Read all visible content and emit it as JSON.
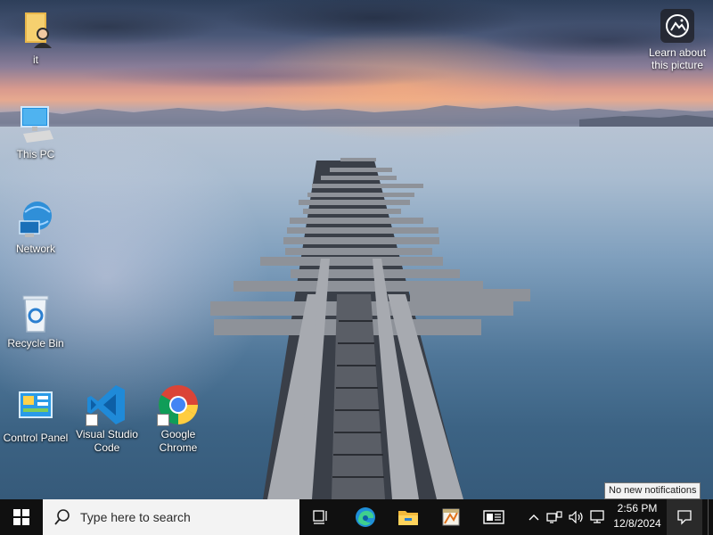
{
  "desktop": {
    "icons": [
      {
        "label": "it"
      },
      {
        "label": "This PC"
      },
      {
        "label": "Network"
      },
      {
        "label": "Recycle Bin"
      },
      {
        "label": "Control Panel"
      },
      {
        "label": "Visual Studio Code"
      },
      {
        "label": "Google Chrome"
      }
    ],
    "learn": {
      "line1": "Learn about",
      "line2": "this picture"
    },
    "tooltip": "No new notifications"
  },
  "taskbar": {
    "search_placeholder": "Type here to search",
    "time": "2:56 PM",
    "date": "12/8/2024",
    "pinned": [
      "task-view",
      "edge",
      "file-explorer",
      "app-installer",
      "news-and-interests"
    ],
    "tray": [
      "chevron-up",
      "network",
      "volume",
      "ime"
    ],
    "colors": {
      "taskbar": "#101010",
      "search_box": "#f3f3f3",
      "accent": "#0078d4"
    }
  }
}
